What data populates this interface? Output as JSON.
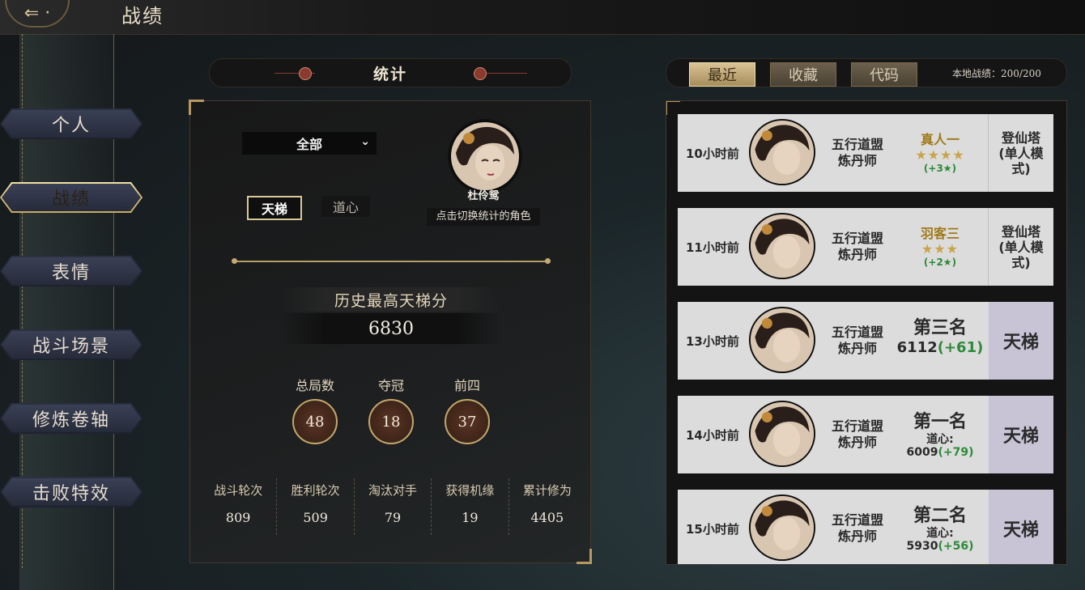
{
  "header": {
    "back_icon": "back-arrow-icon",
    "title": "战绩"
  },
  "sidebar": {
    "items": [
      {
        "label": "个人",
        "active": false
      },
      {
        "label": "战绩",
        "active": true
      },
      {
        "label": "表情",
        "active": false
      },
      {
        "label": "战斗场景",
        "active": false
      },
      {
        "label": "修炼卷轴",
        "active": false
      },
      {
        "label": "击败特效",
        "active": false
      }
    ]
  },
  "stats": {
    "title": "统计",
    "filter": {
      "selected": "全部"
    },
    "tabs": [
      {
        "label": "天梯",
        "active": true
      },
      {
        "label": "道心",
        "active": false
      }
    ],
    "character": {
      "name": "杜伶鸳",
      "hint": "点击切换统计的角色"
    },
    "best_label": "历史最高天梯分",
    "best_value": "6830",
    "circles": [
      {
        "label": "总局数",
        "value": "48"
      },
      {
        "label": "夺冠",
        "value": "18"
      },
      {
        "label": "前四",
        "value": "37"
      }
    ],
    "bottom": [
      {
        "label": "战斗轮次",
        "value": "809"
      },
      {
        "label": "胜利轮次",
        "value": "509"
      },
      {
        "label": "淘汰对手",
        "value": "79"
      },
      {
        "label": "获得机缘",
        "value": "19"
      },
      {
        "label": "累计修为",
        "value": "4405"
      }
    ]
  },
  "records_header": {
    "tabs": [
      {
        "label": "最近",
        "active": true
      },
      {
        "label": "收藏",
        "active": false
      },
      {
        "label": "代码",
        "active": false
      }
    ],
    "local_record": "本地战绩：200/200"
  },
  "records": [
    {
      "time": "10小时前",
      "faction": "五行道盟",
      "role": "炼丹师",
      "rank": "真人一",
      "stars": "★★★★",
      "plus": "(+3★)",
      "mode": "登仙塔\n(单人模\n式)"
    },
    {
      "time": "11小时前",
      "faction": "五行道盟",
      "role": "炼丹师",
      "rank": "羽客三",
      "stars": "★★★",
      "plus": "(+2★)",
      "mode": "登仙塔\n(单人模\n式)"
    },
    {
      "time": "13小时前",
      "faction": "五行道盟",
      "role": "炼丹师",
      "place": "第三名",
      "score": "6112",
      "gain": "(+61)",
      "mode": "天梯"
    },
    {
      "time": "14小时前",
      "faction": "五行道盟",
      "role": "炼丹师",
      "place": "第一名",
      "sub_label": "道心:",
      "score": "6009",
      "gain": "(+79)",
      "mode": "天梯"
    },
    {
      "time": "15小时前",
      "faction": "五行道盟",
      "role": "炼丹师",
      "place": "第二名",
      "sub_label": "道心:",
      "score": "5930",
      "gain": "(+56)",
      "mode": "天梯"
    }
  ],
  "colors": {
    "gold": "#c9a862",
    "panel": "#181818",
    "record_bg": "#dcdcdc",
    "ladder_bg": "#c8c4d6",
    "gain_green": "#2f8a3a"
  }
}
